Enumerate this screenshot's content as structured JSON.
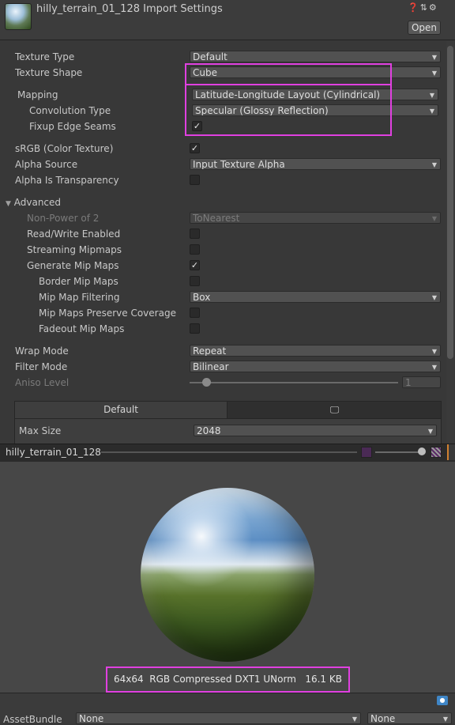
{
  "header": {
    "title": "hilly_terrain_01_128 Import Settings",
    "open_label": "Open",
    "icons": [
      "help-icon",
      "sliders-icon",
      "gear-icon"
    ]
  },
  "fields": {
    "texture_type": {
      "label": "Texture Type",
      "value": "Default"
    },
    "texture_shape": {
      "label": "Texture Shape",
      "value": "Cube"
    },
    "mapping": {
      "label": "Mapping",
      "value": "Latitude-Longitude Layout (Cylindrical)"
    },
    "convolution": {
      "label": "Convolution Type",
      "value": "Specular (Glossy Reflection)"
    },
    "fixup": {
      "label": "Fixup Edge Seams",
      "checked": true
    },
    "srgb": {
      "label": "sRGB (Color Texture)",
      "checked": true
    },
    "alpha_source": {
      "label": "Alpha Source",
      "value": "Input Texture Alpha"
    },
    "alpha_transparency": {
      "label": "Alpha Is Transparency",
      "checked": false
    },
    "advanced": {
      "label": "Advanced"
    },
    "npot": {
      "label": "Non-Power of 2",
      "value": "ToNearest"
    },
    "readwrite": {
      "label": "Read/Write Enabled",
      "checked": false
    },
    "streaming": {
      "label": "Streaming Mipmaps",
      "checked": false
    },
    "genmips": {
      "label": "Generate Mip Maps",
      "checked": true
    },
    "bordermips": {
      "label": "Border Mip Maps",
      "checked": false
    },
    "mipfilter": {
      "label": "Mip Map Filtering",
      "value": "Box"
    },
    "mippreserve": {
      "label": "Mip Maps Preserve Coverage",
      "checked": false
    },
    "fademips": {
      "label": "Fadeout Mip Maps",
      "checked": false
    },
    "wrap": {
      "label": "Wrap Mode",
      "value": "Repeat"
    },
    "filter": {
      "label": "Filter Mode",
      "value": "Bilinear"
    },
    "aniso": {
      "label": "Aniso Level",
      "value": "1",
      "fraction": 0.0
    }
  },
  "platform_tabs": {
    "default_label": "Default",
    "second_icon": "monitor-icon"
  },
  "maxsize": {
    "label": "Max Size",
    "value": "2048"
  },
  "preview": {
    "name": "hilly_terrain_01_128",
    "info": "64x64  RGB Compressed DXT1 UNorm   16.1 KB",
    "mip_fraction": 1.0
  },
  "assetbundle": {
    "label": "AssetBundle",
    "name_value": "None",
    "variant_value": "None"
  },
  "colors": {
    "highlight": "#e040e0",
    "background": "#383838"
  }
}
